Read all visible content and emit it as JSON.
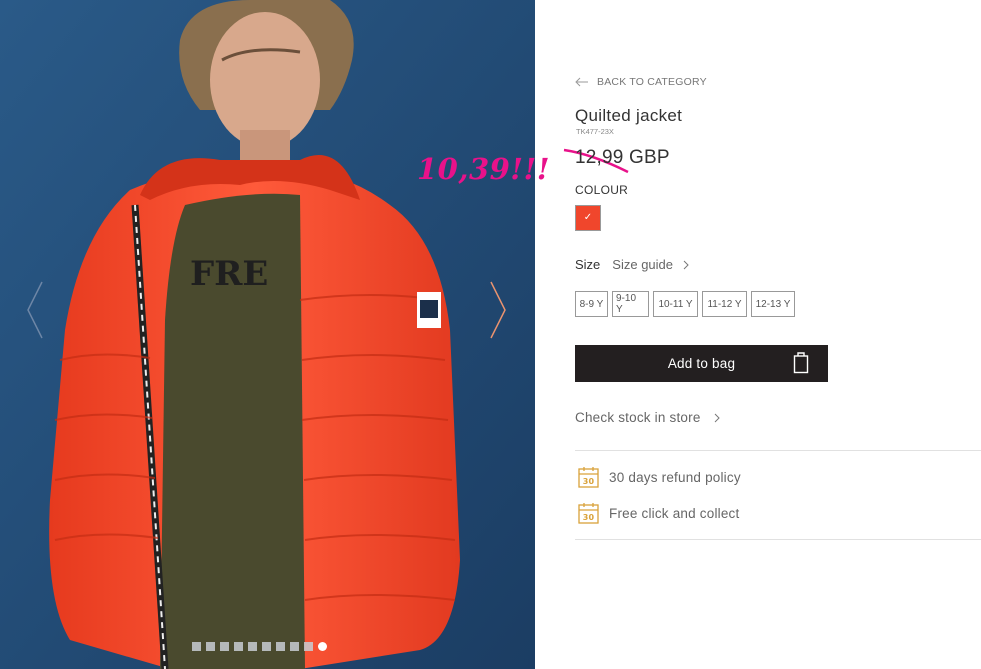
{
  "product": {
    "back_label": "BACK TO CATEGORY",
    "title": "Quilted jacket",
    "sku": "TK477-23X",
    "price": "12,99 GBP",
    "annotation": "10,39!!!"
  },
  "colour": {
    "label": "COLOUR",
    "selected_hex": "#f0462c"
  },
  "size": {
    "label": "Size",
    "guide_label": "Size guide",
    "options": [
      "8-9 Y",
      "9-10 Y",
      "10-11 Y",
      "11-12 Y",
      "12-13 Y"
    ]
  },
  "actions": {
    "add_to_bag": "Add to bag",
    "check_stock": "Check stock in store"
  },
  "perks": [
    "30 days refund policy",
    "Free click and collect"
  ],
  "gallery": {
    "image_count": 10,
    "active_index": 9
  },
  "colors": {
    "background_photo": "#1f4770",
    "jacket": "#f0462c",
    "button_dark": "#231f20",
    "annotation_pink": "#e8128a",
    "perk_icon_gold": "#d9a23a"
  }
}
